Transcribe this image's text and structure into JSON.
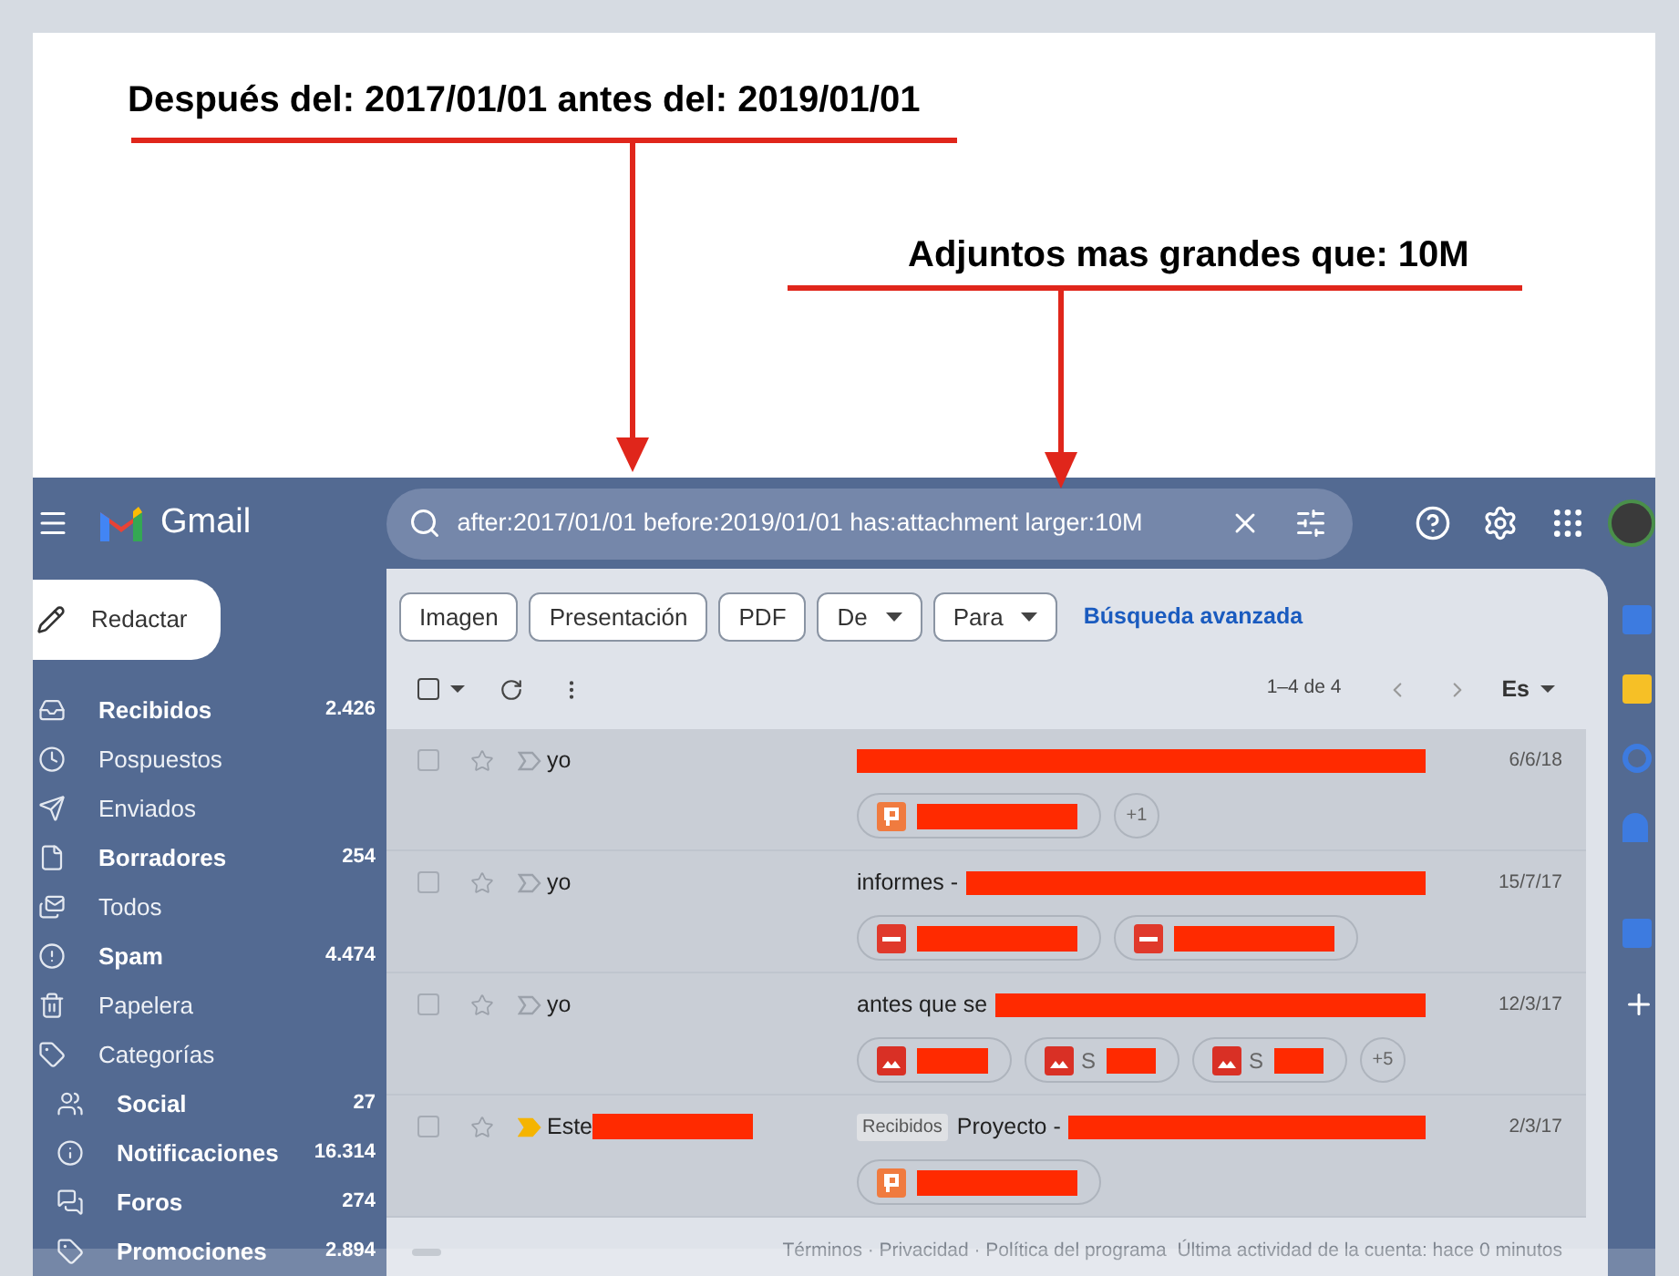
{
  "annotations": [
    {
      "text": "Después del: 2017/01/01 antes del: 2019/01/01"
    },
    {
      "text": "Adjuntos mas grandes que: 10M"
    }
  ],
  "header": {
    "app_name": "Gmail",
    "search": {
      "value": "after:2017/01/01 before:2019/01/01 has:attachment larger:10M"
    }
  },
  "compose": "Redactar",
  "sidebar": {
    "items": [
      {
        "kind": "inbox",
        "label": "Recibidos",
        "count": "2.426",
        "bold": true
      },
      {
        "kind": "snoozed",
        "label": "Pospuestos",
        "bold": false
      },
      {
        "kind": "sent",
        "label": "Enviados",
        "bold": false
      },
      {
        "kind": "drafts",
        "label": "Borradores",
        "count": "254",
        "bold": true
      },
      {
        "kind": "all",
        "label": "Todos",
        "bold": false
      },
      {
        "kind": "spam",
        "label": "Spam",
        "count": "4.474",
        "bold": true
      },
      {
        "kind": "trash",
        "label": "Papelera",
        "bold": false
      },
      {
        "kind": "label",
        "label": "Categorías",
        "bold": false,
        "children": [
          {
            "kind": "social",
            "label": "Social",
            "count": "27",
            "bold": true
          },
          {
            "kind": "updates",
            "label": "Notificaciones",
            "count": "16.314",
            "bold": true
          },
          {
            "kind": "forums",
            "label": "Foros",
            "count": "274",
            "bold": true
          },
          {
            "kind": "promotions",
            "label": "Promociones",
            "count": "2.894",
            "bold": true
          }
        ]
      }
    ]
  },
  "filters": [
    {
      "label": "Imagen",
      "dropdown": false
    },
    {
      "label": "Presentación",
      "dropdown": false
    },
    {
      "label": "PDF",
      "dropdown": false
    },
    {
      "label": "De",
      "dropdown": true
    },
    {
      "label": "Para",
      "dropdown": true
    }
  ],
  "advanced_search": "Búsqueda avanzada",
  "toolbar": {
    "select_all_checked": false,
    "range": "1–4 de 4",
    "language": "Es"
  },
  "emails": [
    {
      "checked": false,
      "sender": "yo",
      "sender_redacted": false,
      "important": false,
      "date": "6/6/18",
      "attachments": [
        {
          "kind": "slides"
        }
      ],
      "more": "+1"
    },
    {
      "checked": false,
      "sender": "yo",
      "sender_redacted": false,
      "important": false,
      "subject": "informes -",
      "date": "15/7/17",
      "attachments": [
        {
          "kind": "pdf"
        },
        {
          "kind": "pdf"
        }
      ]
    },
    {
      "checked": false,
      "sender": "yo",
      "sender_redacted": false,
      "important": false,
      "subject": "antes que se",
      "date": "12/3/17",
      "attachments": [
        {
          "kind": "image"
        },
        {
          "kind": "image",
          "text": "S"
        },
        {
          "kind": "image",
          "text": "S"
        }
      ],
      "more": "+5"
    },
    {
      "checked": false,
      "sender": "Este",
      "sender_redacted": true,
      "important": true,
      "tag": "Recibidos",
      "subject": "Proyecto -",
      "date": "2/3/17",
      "attachments": [
        {
          "kind": "slides"
        }
      ]
    }
  ],
  "footer": "Términos · Privacidad · Política del programa  Última actividad de la cuenta: hace 0 minutos"
}
